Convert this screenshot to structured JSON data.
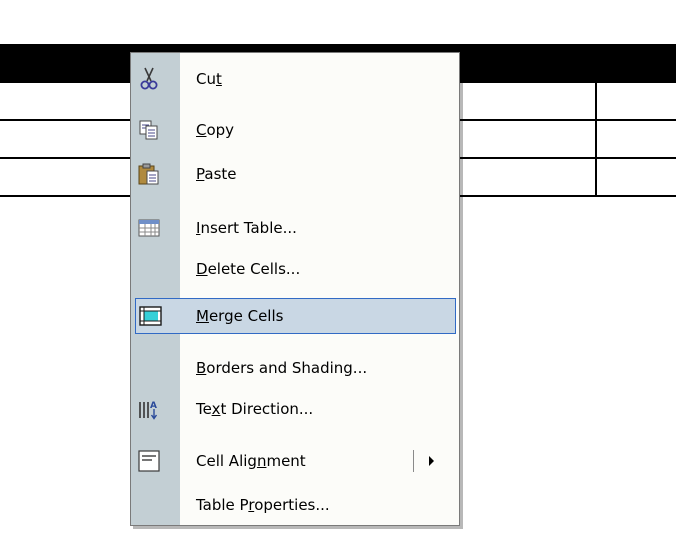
{
  "context_menu": {
    "items": [
      {
        "name": "cut",
        "icon": "scissors-icon",
        "label_pre": "Cu",
        "mnemonic": "t",
        "label_post": ""
      },
      {
        "name": "copy",
        "icon": "copy-icon",
        "label_pre": "",
        "mnemonic": "C",
        "label_post": "opy"
      },
      {
        "name": "paste",
        "icon": "paste-icon",
        "label_pre": "",
        "mnemonic": "P",
        "label_post": "aste"
      },
      {
        "name": "insert-table",
        "icon": "table-icon",
        "label_pre": "",
        "mnemonic": "I",
        "label_post": "nsert Table..."
      },
      {
        "name": "delete-cells",
        "icon": "",
        "label_pre": "",
        "mnemonic": "D",
        "label_post": "elete Cells..."
      },
      {
        "name": "merge-cells",
        "icon": "merge-cells-icon",
        "label_pre": "",
        "mnemonic": "M",
        "label_post": "erge Cells",
        "highlighted": true
      },
      {
        "name": "borders-and-shading",
        "icon": "",
        "label_pre": "",
        "mnemonic": "B",
        "label_post": "orders and Shading..."
      },
      {
        "name": "text-direction",
        "icon": "text-direction-icon",
        "label_pre": "Te",
        "mnemonic": "x",
        "label_post": "t Direction..."
      },
      {
        "name": "cell-alignment",
        "icon": "cell-alignment-icon",
        "label_pre": "Cell Alig",
        "mnemonic": "n",
        "label_post": "ment",
        "has_submenu": true
      },
      {
        "name": "table-properties",
        "icon": "",
        "label_pre": "Table P",
        "mnemonic": "r",
        "label_post": "operties..."
      }
    ]
  },
  "colors": {
    "gutter": "#c3cfd4",
    "menu_bg": "#fcfcf9",
    "highlight_bg": "#c9d7e4",
    "highlight_border": "#316ac5"
  }
}
